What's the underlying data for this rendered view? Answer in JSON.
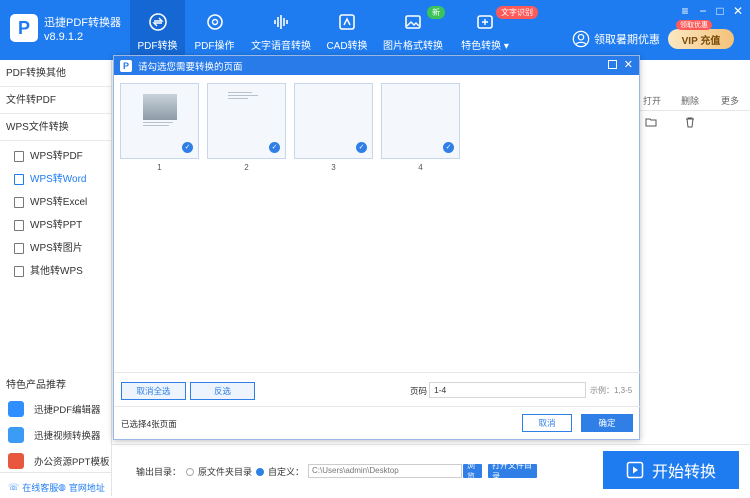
{
  "app": {
    "name": "迅捷PDF转换器",
    "version": "v8.9.1.2",
    "logo_glyph": "P"
  },
  "nav": [
    {
      "label": "PDF转换",
      "icon": "convert-icon"
    },
    {
      "label": "PDF操作",
      "icon": "gear-icon"
    },
    {
      "label": "文字语音转换",
      "icon": "audio-wave-icon"
    },
    {
      "label": "CAD转换",
      "icon": "cad-icon"
    },
    {
      "label": "图片格式转换",
      "icon": "image-icon"
    },
    {
      "label": "特色转换",
      "icon": "special-icon"
    }
  ],
  "badges": {
    "new": "新",
    "ocr": "文字识别"
  },
  "promo": {
    "label": "领取暑期优惠",
    "vip_badge": "领取优惠",
    "vip_label": "VIP 充值"
  },
  "window_controls": {
    "menu": "≡",
    "minimize": "−",
    "maximize": "□",
    "close": "✕"
  },
  "sidebar": {
    "categories": [
      "PDF转换其他",
      "文件转PDF",
      "WPS文件转换"
    ],
    "items": [
      "WPS转PDF",
      "WPS转Word",
      "WPS转Excel",
      "WPS转PPT",
      "WPS转图片",
      "其他转WPS"
    ],
    "featured_title": "特色产品推荐",
    "featured": [
      "迅捷PDF编辑器",
      "迅捷视频转换器",
      "办公资源PPT模板"
    ],
    "footer": [
      "在线客服",
      "官网地址"
    ]
  },
  "right": {
    "headers": [
      "打开",
      "删除",
      "更多"
    ]
  },
  "dialog": {
    "title": "请勾选您需要转换的页面",
    "pages": [
      "1",
      "2",
      "3",
      "4"
    ],
    "check": "✓",
    "deselect_all": "取消全选",
    "invert": "反选",
    "page_label": "页码",
    "page_value": "1-4",
    "example": "示例：1,3-5",
    "selected_count": "已选择4张页面",
    "cancel": "取消",
    "confirm": "确定"
  },
  "bottom": {
    "output_label": "输出目录：",
    "opt_original": "原文件夹目录",
    "opt_custom": "自定义：",
    "path": "C:\\Users\\admin\\Desktop",
    "browse": "浏览",
    "open_folder": "打开文件目录",
    "start": "开始转换"
  },
  "colors": {
    "brand": "#1f7cf0",
    "active_nav": "#1567d3"
  }
}
